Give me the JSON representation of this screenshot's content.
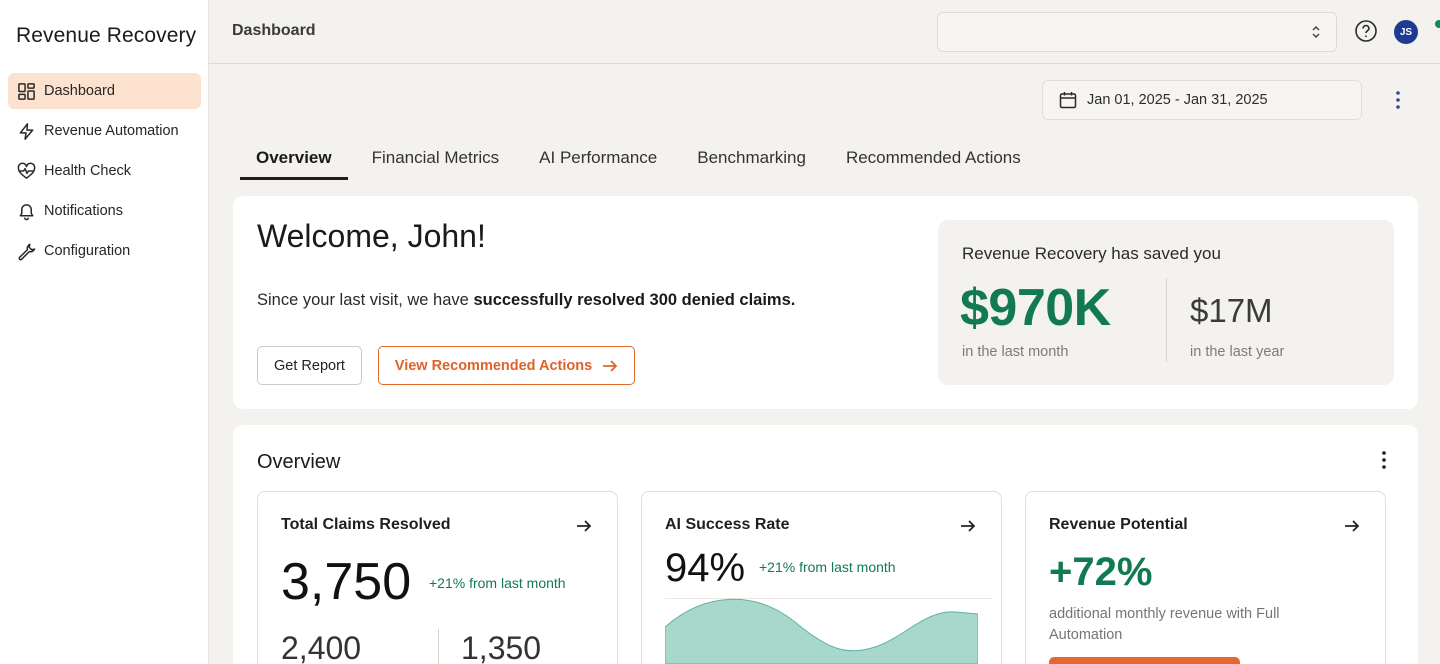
{
  "app": {
    "name": "Revenue Recovery"
  },
  "sidebar": {
    "items": [
      {
        "label": "Dashboard",
        "icon": "grid-icon",
        "active": true
      },
      {
        "label": "Revenue Automation",
        "icon": "lightning-icon",
        "active": false
      },
      {
        "label": "Health Check",
        "icon": "heart-pulse-icon",
        "active": false
      },
      {
        "label": "Notifications",
        "icon": "bell-icon",
        "active": false
      },
      {
        "label": "Configuration",
        "icon": "wrench-icon",
        "active": false
      }
    ]
  },
  "header": {
    "title": "Dashboard",
    "org_select_value": "",
    "user_initials": "JS"
  },
  "date_range": {
    "value": "Jan 01, 2025 - Jan 31, 2025"
  },
  "tabs": [
    {
      "label": "Overview",
      "active": true
    },
    {
      "label": "Financial Metrics",
      "active": false
    },
    {
      "label": "AI Performance",
      "active": false
    },
    {
      "label": "Benchmarking",
      "active": false
    },
    {
      "label": "Recommended Actions",
      "active": false
    }
  ],
  "welcome": {
    "title": "Welcome, John!",
    "sub_prefix": "Since your last visit, we have ",
    "sub_bold": "successfully resolved 300 denied claims.",
    "get_report_label": "Get Report",
    "view_actions_label": "View Recommended Actions"
  },
  "savings": {
    "title": "Revenue Recovery has saved you",
    "month_value": "$970K",
    "month_label": "in the last month",
    "year_value": "$17M",
    "year_label": "in the last year"
  },
  "overview": {
    "title": "Overview",
    "cards": {
      "claims": {
        "title": "Total Claims Resolved",
        "value": "3,750",
        "delta": "+21% from last month",
        "sub_a": "2,400",
        "sub_b": "1,350"
      },
      "ai": {
        "title": "AI Success Rate",
        "value": "94%",
        "delta": "+21% from last month"
      },
      "potential": {
        "title": "Revenue Potential",
        "value": "+72%",
        "description": "additional monthly revenue with Full Automation"
      }
    }
  },
  "colors": {
    "accent_orange": "#e5682f",
    "success_green": "#127a52",
    "active_nav_bg": "#fde2cf",
    "area_fill": "#a8d8cc"
  }
}
